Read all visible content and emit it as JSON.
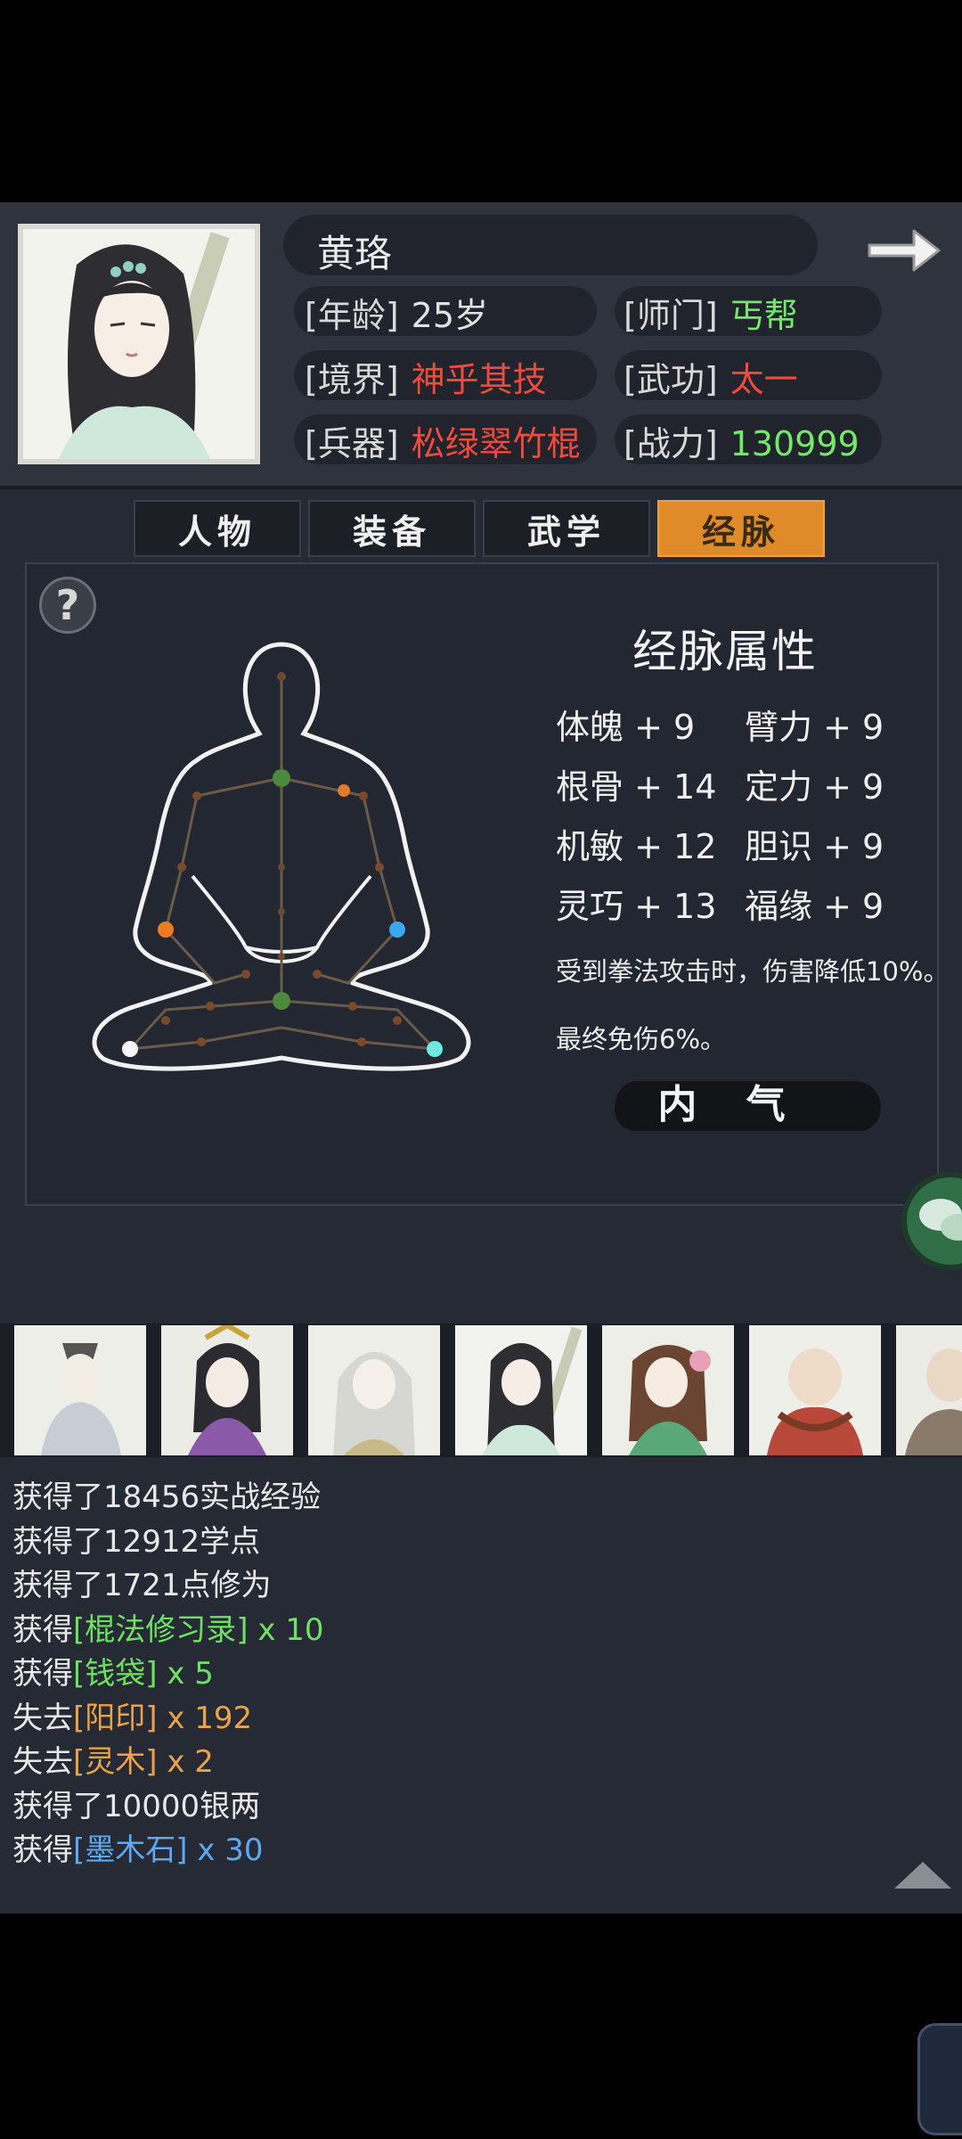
{
  "character": {
    "name": "黄珞",
    "age_label": "[年龄]",
    "age_value": "25岁",
    "sect_label": "[师门]",
    "sect_value": "丐帮",
    "realm_label": "[境界]",
    "realm_value": "神乎其技",
    "skill_label": "[武功]",
    "skill_value": "太一",
    "weapon_label": "[兵器]",
    "weapon_value": "松绿翠竹棍",
    "power_label": "[战力]",
    "power_value": "130999"
  },
  "tabs": [
    "人物",
    "装备",
    "武学",
    "经脉"
  ],
  "active_tab": "经脉",
  "panel": {
    "help": "?",
    "title": "经脉属性",
    "stats": [
      {
        "name": "体魄",
        "value": "+ 9"
      },
      {
        "name": "臂力",
        "value": "+ 9"
      },
      {
        "name": "根骨",
        "value": "+ 14"
      },
      {
        "name": "定力",
        "value": "+ 9"
      },
      {
        "name": "机敏",
        "value": "+ 12"
      },
      {
        "name": "胆识",
        "value": "+ 9"
      },
      {
        "name": "灵巧",
        "value": "+ 13"
      },
      {
        "name": "福缘",
        "value": "+ 9"
      }
    ],
    "effect1": "受到拳法攻击时，伤害降低10%。",
    "effect2": "最终免伤6%。",
    "neiqi_button": "内 气"
  },
  "log": [
    {
      "prefix": "获得了",
      "text": "18456实战经验",
      "item": "",
      "suffix": ""
    },
    {
      "prefix": "获得了",
      "text": "12912学点",
      "item": "",
      "suffix": ""
    },
    {
      "prefix": "获得了",
      "text": "1721点修为",
      "item": "",
      "suffix": ""
    },
    {
      "prefix": "获得",
      "text": "",
      "item": "[棍法修习录]",
      "suffix": " x 10"
    },
    {
      "prefix": "获得",
      "text": "",
      "item": "[钱袋]",
      "suffix": " x 5"
    },
    {
      "prefix": "失去",
      "text": "",
      "item": "[阳印]",
      "suffix": " x 192"
    },
    {
      "prefix": "失去",
      "text": "",
      "item": "[灵木]",
      "suffix": " x 2"
    },
    {
      "prefix": "获得了",
      "text": "10000银两",
      "item": "",
      "suffix": ""
    },
    {
      "prefix": "获得",
      "text": "",
      "item": "[墨木石]",
      "suffix": " x 30"
    }
  ],
  "colors": {
    "accent_tab": "#e08b2a",
    "green": "#74e86a",
    "red": "#f04a3c",
    "item_orange": "#e8a24a",
    "item_blue": "#5ea8ee"
  }
}
